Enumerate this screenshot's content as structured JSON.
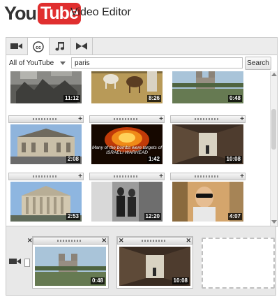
{
  "header": {
    "logo": {
      "you": "You",
      "tube": "Tube"
    },
    "title": "Video Editor"
  },
  "tabs": [
    {
      "icon": "video-camera-icon",
      "active": false
    },
    {
      "icon": "cc-icon",
      "active": true
    },
    {
      "icon": "music-note-icon",
      "active": false
    },
    {
      "icon": "transition-icon",
      "active": false
    }
  ],
  "search": {
    "scope": "All of YouTube",
    "query": "paris",
    "button": "Search"
  },
  "results": [
    {
      "duration": "11:12"
    },
    {
      "duration": "8:26"
    },
    {
      "duration": "0:48"
    },
    {
      "duration": "2:08"
    },
    {
      "duration": "1:42",
      "caption": "Many of the bombs were targets of ISRAELI WARHEAD"
    },
    {
      "duration": "10:08"
    },
    {
      "duration": "2:53"
    },
    {
      "duration": "12:20"
    },
    {
      "duration": "4:07"
    }
  ],
  "timeline": {
    "clips": [
      {
        "duration": "0:48"
      },
      {
        "duration": "10:08"
      }
    ]
  },
  "colors": {
    "brand_red": "#e02f2f"
  }
}
